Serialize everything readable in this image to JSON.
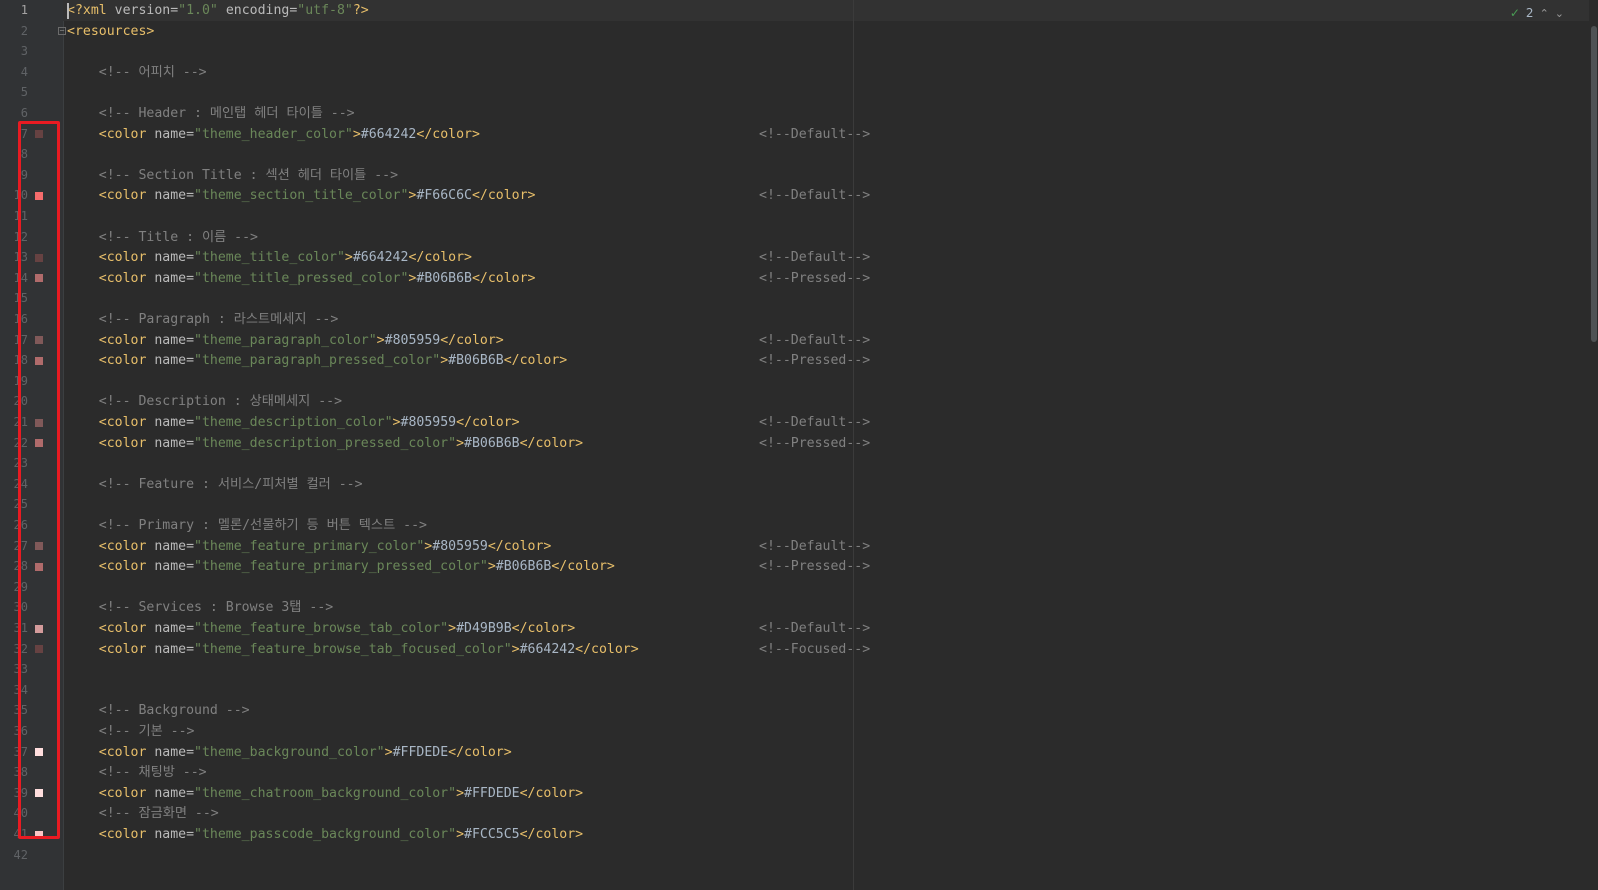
{
  "editor": {
    "indicator": {
      "count": "2"
    },
    "lines": [
      {
        "n": "1",
        "segments": [
          [
            "tag",
            "<?xml "
          ],
          [
            "attr",
            "version="
          ],
          [
            "val",
            "\"1.0\""
          ],
          [
            "attr",
            " encoding="
          ],
          [
            "val",
            "\"utf-8\""
          ],
          [
            "tag",
            "?>"
          ]
        ],
        "current": true
      },
      {
        "n": "2",
        "segments": [
          [
            "tag",
            "<resources>"
          ]
        ],
        "fold": true
      },
      {
        "n": "3",
        "segments": []
      },
      {
        "n": "4",
        "segments": [
          [
            "cmt",
            "    <!-- 어피치 -->"
          ]
        ]
      },
      {
        "n": "5",
        "segments": []
      },
      {
        "n": "6",
        "segments": [
          [
            "cmt",
            "    <!-- Header : 메인탭 헤더 타이틀 -->"
          ]
        ]
      },
      {
        "n": "7",
        "segments": [
          [
            "tag",
            "    <color "
          ],
          [
            "attr",
            "name="
          ],
          [
            "val",
            "\"theme_header_color\""
          ],
          [
            "tag",
            ">"
          ],
          [
            "text",
            "#664242"
          ],
          [
            "tag",
            "</color>"
          ]
        ],
        "comment": "<!--Default-->",
        "swatch": "#664242"
      },
      {
        "n": "8",
        "segments": []
      },
      {
        "n": "9",
        "segments": [
          [
            "cmt",
            "    <!-- Section Title : 섹션 헤더 타이틀 -->"
          ]
        ]
      },
      {
        "n": "10",
        "segments": [
          [
            "tag",
            "    <color "
          ],
          [
            "attr",
            "name="
          ],
          [
            "val",
            "\"theme_section_title_color\""
          ],
          [
            "tag",
            ">"
          ],
          [
            "text",
            "#F66C6C"
          ],
          [
            "tag",
            "</color>"
          ]
        ],
        "comment": "<!--Default-->",
        "swatch": "#F66C6C"
      },
      {
        "n": "11",
        "segments": []
      },
      {
        "n": "12",
        "segments": [
          [
            "cmt",
            "    <!-- Title : 이름 -->"
          ]
        ]
      },
      {
        "n": "13",
        "segments": [
          [
            "tag",
            "    <color "
          ],
          [
            "attr",
            "name="
          ],
          [
            "val",
            "\"theme_title_color\""
          ],
          [
            "tag",
            ">"
          ],
          [
            "text",
            "#664242"
          ],
          [
            "tag",
            "</color>"
          ]
        ],
        "comment": "<!--Default-->",
        "swatch": "#664242"
      },
      {
        "n": "14",
        "segments": [
          [
            "tag",
            "    <color "
          ],
          [
            "attr",
            "name="
          ],
          [
            "val",
            "\"theme_title_pressed_color\""
          ],
          [
            "tag",
            ">"
          ],
          [
            "text",
            "#B06B6B"
          ],
          [
            "tag",
            "</color>"
          ]
        ],
        "comment": "<!--Pressed-->",
        "swatch": "#B06B6B"
      },
      {
        "n": "15",
        "segments": []
      },
      {
        "n": "16",
        "segments": [
          [
            "cmt",
            "    <!-- Paragraph : 라스트메세지 -->"
          ]
        ]
      },
      {
        "n": "17",
        "segments": [
          [
            "tag",
            "    <color "
          ],
          [
            "attr",
            "name="
          ],
          [
            "val",
            "\"theme_paragraph_color\""
          ],
          [
            "tag",
            ">"
          ],
          [
            "text",
            "#805959"
          ],
          [
            "tag",
            "</color>"
          ]
        ],
        "comment": "<!--Default-->",
        "swatch": "#805959"
      },
      {
        "n": "18",
        "segments": [
          [
            "tag",
            "    <color "
          ],
          [
            "attr",
            "name="
          ],
          [
            "val",
            "\"theme_paragraph_pressed_color\""
          ],
          [
            "tag",
            ">"
          ],
          [
            "text",
            "#B06B6B"
          ],
          [
            "tag",
            "</color>"
          ]
        ],
        "comment": "<!--Pressed-->",
        "swatch": "#B06B6B"
      },
      {
        "n": "19",
        "segments": []
      },
      {
        "n": "20",
        "segments": [
          [
            "cmt",
            "    <!-- Description : 상태메세지 -->"
          ]
        ]
      },
      {
        "n": "21",
        "segments": [
          [
            "tag",
            "    <color "
          ],
          [
            "attr",
            "name="
          ],
          [
            "val",
            "\"theme_description_color\""
          ],
          [
            "tag",
            ">"
          ],
          [
            "text",
            "#805959"
          ],
          [
            "tag",
            "</color>"
          ]
        ],
        "comment": "<!--Default-->",
        "swatch": "#805959"
      },
      {
        "n": "22",
        "segments": [
          [
            "tag",
            "    <color "
          ],
          [
            "attr",
            "name="
          ],
          [
            "val",
            "\"theme_description_pressed_color\""
          ],
          [
            "tag",
            ">"
          ],
          [
            "text",
            "#B06B6B"
          ],
          [
            "tag",
            "</color>"
          ]
        ],
        "comment": "<!--Pressed-->",
        "swatch": "#B06B6B"
      },
      {
        "n": "23",
        "segments": []
      },
      {
        "n": "24",
        "segments": [
          [
            "cmt",
            "    <!-- Feature : 서비스/피처별 컬러 -->"
          ]
        ]
      },
      {
        "n": "25",
        "segments": []
      },
      {
        "n": "26",
        "segments": [
          [
            "cmt",
            "    <!-- Primary : 멜론/선물하기 등 버튼 텍스트 -->"
          ]
        ]
      },
      {
        "n": "27",
        "segments": [
          [
            "tag",
            "    <color "
          ],
          [
            "attr",
            "name="
          ],
          [
            "val",
            "\"theme_feature_primary_color\""
          ],
          [
            "tag",
            ">"
          ],
          [
            "text",
            "#805959"
          ],
          [
            "tag",
            "</color>"
          ]
        ],
        "comment": "<!--Default-->",
        "swatch": "#805959"
      },
      {
        "n": "28",
        "segments": [
          [
            "tag",
            "    <color "
          ],
          [
            "attr",
            "name="
          ],
          [
            "val",
            "\"theme_feature_primary_pressed_color\""
          ],
          [
            "tag",
            ">"
          ],
          [
            "text",
            "#B06B6B"
          ],
          [
            "tag",
            "</color>"
          ]
        ],
        "comment": "<!--Pressed-->",
        "swatch": "#B06B6B"
      },
      {
        "n": "29",
        "segments": []
      },
      {
        "n": "30",
        "segments": [
          [
            "cmt",
            "    <!-- Services : Browse 3탭 -->"
          ]
        ]
      },
      {
        "n": "31",
        "segments": [
          [
            "tag",
            "    <color "
          ],
          [
            "attr",
            "name="
          ],
          [
            "val",
            "\"theme_feature_browse_tab_color\""
          ],
          [
            "tag",
            ">"
          ],
          [
            "text",
            "#D49B9B"
          ],
          [
            "tag",
            "</color>"
          ]
        ],
        "comment": "<!--Default-->",
        "swatch": "#D49B9B"
      },
      {
        "n": "32",
        "segments": [
          [
            "tag",
            "    <color "
          ],
          [
            "attr",
            "name="
          ],
          [
            "val",
            "\"theme_feature_browse_tab_focused_color\""
          ],
          [
            "tag",
            ">"
          ],
          [
            "text",
            "#664242"
          ],
          [
            "tag",
            "</color>"
          ]
        ],
        "comment": "<!--Focused-->",
        "swatch": "#664242"
      },
      {
        "n": "33",
        "segments": []
      },
      {
        "n": "34",
        "segments": []
      },
      {
        "n": "35",
        "segments": [
          [
            "cmt",
            "    <!-- Background -->"
          ]
        ]
      },
      {
        "n": "36",
        "segments": [
          [
            "cmt",
            "    <!-- 기본 -->"
          ]
        ]
      },
      {
        "n": "37",
        "segments": [
          [
            "tag",
            "    <color "
          ],
          [
            "attr",
            "name="
          ],
          [
            "val",
            "\"theme_background_color\""
          ],
          [
            "tag",
            ">"
          ],
          [
            "text",
            "#FFDEDE"
          ],
          [
            "tag",
            "</color>"
          ]
        ],
        "swatch": "#FFDEDE"
      },
      {
        "n": "38",
        "segments": [
          [
            "cmt",
            "    <!-- 채팅방 -->"
          ]
        ]
      },
      {
        "n": "39",
        "segments": [
          [
            "tag",
            "    <color "
          ],
          [
            "attr",
            "name="
          ],
          [
            "val",
            "\"theme_chatroom_background_color\""
          ],
          [
            "tag",
            ">"
          ],
          [
            "text",
            "#FFDEDE"
          ],
          [
            "tag",
            "</color>"
          ]
        ],
        "swatch": "#FFDEDE"
      },
      {
        "n": "40",
        "segments": [
          [
            "cmt",
            "    <!-- 잠금화면 -->"
          ]
        ]
      },
      {
        "n": "41",
        "segments": [
          [
            "tag",
            "    <color "
          ],
          [
            "attr",
            "name="
          ],
          [
            "val",
            "\"theme_passcode_background_color\""
          ],
          [
            "tag",
            ">"
          ],
          [
            "text",
            "#FCC5C5"
          ],
          [
            "tag",
            "</color>"
          ]
        ],
        "swatch": "#FCC5C5"
      },
      {
        "n": "42",
        "segments": []
      }
    ]
  }
}
